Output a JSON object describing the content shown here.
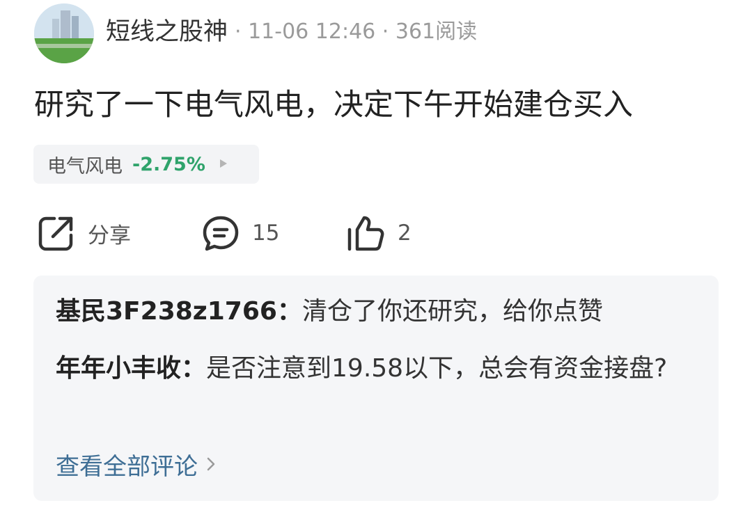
{
  "post": {
    "author": "短线之股神",
    "meta": "· 11-06 12:46 · 361阅读",
    "title": "研究了一下电气风电，决定下午开始建仓买入"
  },
  "stock_tag": {
    "name": "电气风电",
    "change": "-2.75%",
    "change_color": "#2fa36b"
  },
  "actions": {
    "share_label": "分享",
    "comment_count": "15",
    "like_count": "2",
    "icons": [
      "share-icon",
      "comment-icon",
      "thumbs-up-icon"
    ]
  },
  "comments": [
    {
      "user": "基民3F238z1766：",
      "text": "清仓了你还研究，给你点赞"
    },
    {
      "user": "年年小丰收：",
      "text": "是否注意到19.58以下，总会有资金接盘?"
    }
  ],
  "view_all": "查看全部评论",
  "colors": {
    "link": "#3e6e95",
    "tag_bg": "#f3f4f6",
    "comments_bg": "#f5f6f8"
  }
}
